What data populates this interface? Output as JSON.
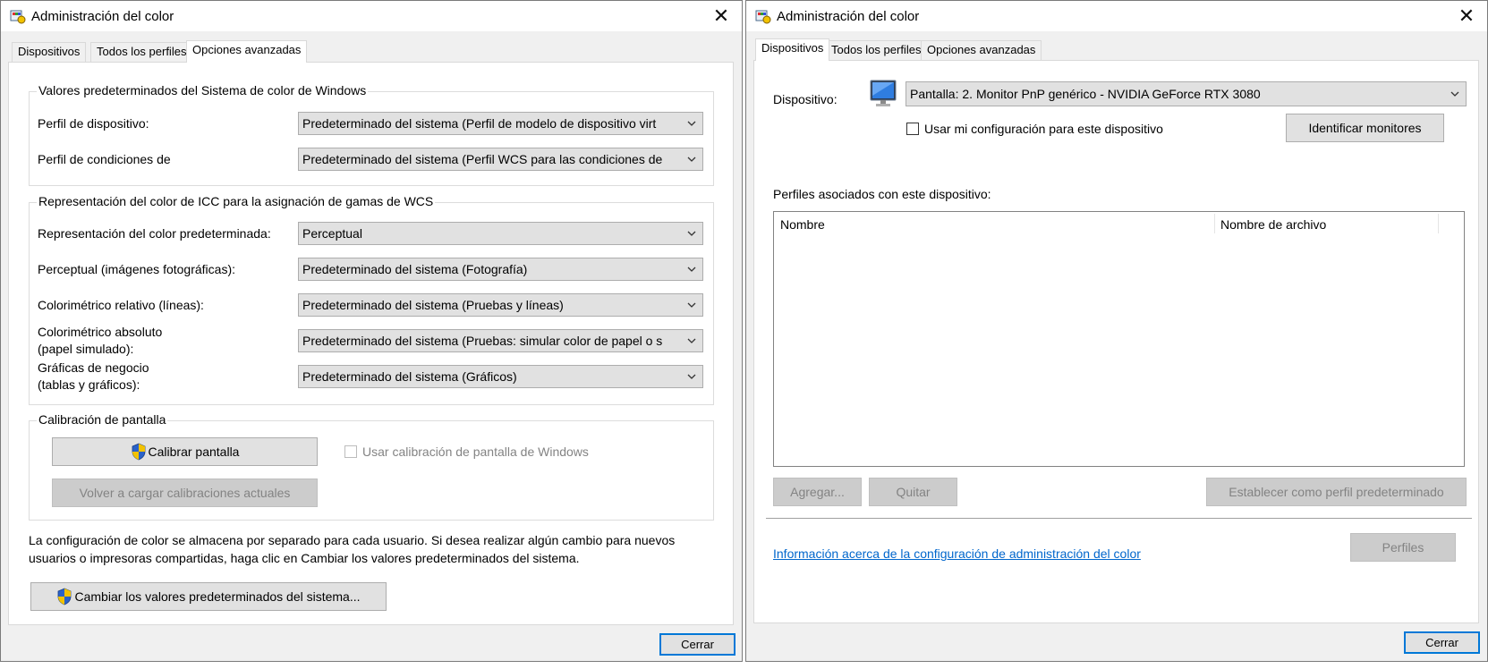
{
  "colors": {
    "accent": "#0078d7",
    "link": "#0066cc",
    "disabled_text": "#838383"
  },
  "left_window": {
    "title": "Administración del color",
    "close_glyph": "✕",
    "tabs": [
      {
        "label": "Dispositivos"
      },
      {
        "label": "Todos los perfiles"
      },
      {
        "label": "Opciones avanzadas"
      }
    ],
    "active_tab": "Opciones avanzadas",
    "wcs_defaults": {
      "title": "Valores predeterminados del Sistema de color de Windows",
      "device_profile_label": "Perfil de dispositivo:",
      "device_profile_value": "Predeterminado del sistema (Perfil de modelo de dispositivo virt",
      "viewing_conditions_label": "Perfil de condiciones de",
      "viewing_conditions_value": "Predeterminado del sistema (Perfil WCS para las condiciones de"
    },
    "icc_rendering": {
      "title": "Representación del color de ICC para la asignación de gamas de WCS",
      "default_intent_label": "Representación del color predeterminada:",
      "default_intent_value": "Perceptual",
      "perceptual_label": "Perceptual (imágenes fotográficas):",
      "perceptual_value": "Predeterminado del sistema (Fotografía)",
      "relative_label": "Colorimétrico relativo (líneas):",
      "relative_value": "Predeterminado del sistema (Pruebas y líneas)",
      "absolute_label_1": "Colorimétrico absoluto",
      "absolute_label_2": "(papel simulado):",
      "absolute_value": "Predeterminado del sistema (Pruebas: simular color de papel o s",
      "business_label_1": "Gráficas de negocio",
      "business_label_2": "(tablas y gráficos):",
      "business_value": "Predeterminado del sistema (Gráficos)"
    },
    "calibration": {
      "title": "Calibración de pantalla",
      "calibrate_button": "Calibrar pantalla",
      "reload_button": "Volver a cargar calibraciones actuales",
      "use_windows_calibration": "Usar calibración de pantalla de Windows"
    },
    "note_line_1": "La configuración de color se almacena por separado para cada usuario. Si desea realizar algún cambio para nuevos",
    "note_line_2": "usuarios o impresoras compartidas, haga clic en Cambiar los valores predeterminados del sistema.",
    "change_defaults_button": "Cambiar los valores predeterminados del sistema...",
    "close_button": "Cerrar"
  },
  "right_window": {
    "title": "Administración del color",
    "close_glyph": "✕",
    "tabs": [
      {
        "label": "Dispositivos"
      },
      {
        "label": "Todos los perfiles"
      },
      {
        "label": "Opciones avanzadas"
      }
    ],
    "active_tab": "Dispositivos",
    "device_label": "Dispositivo:",
    "device_value": "Pantalla: 2. Monitor PnP genérico - NVIDIA GeForce RTX 3080",
    "use_my_settings": "Usar mi configuración para este dispositivo",
    "identify_button": "Identificar monitores",
    "profiles_label": "Perfiles asociados con este dispositivo:",
    "columns": [
      "Nombre",
      "Nombre de archivo"
    ],
    "add_button": "Agregar...",
    "remove_button": "Quitar",
    "set_default_button": "Establecer como perfil predeterminado",
    "info_link": "Información acerca de la configuración de administración del color",
    "profiles_button": "Perfiles",
    "close_button": "Cerrar"
  }
}
